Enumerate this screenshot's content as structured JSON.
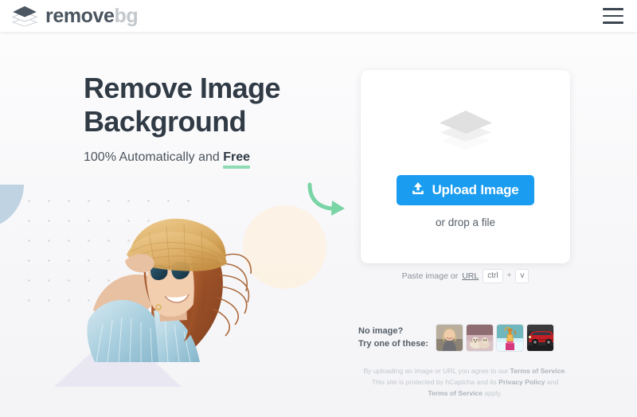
{
  "header": {
    "logo_text_primary": "remove",
    "logo_text_secondary": "bg",
    "logo_icon": "layers-icon",
    "menu_icon": "hamburger-menu-icon"
  },
  "hero": {
    "title_line1": "Remove Image",
    "title_line2": "Background",
    "subtitle_prefix": "100% Automatically and ",
    "subtitle_highlight": "Free",
    "photo_alt": "woman-with-straw-hat-and-sunglasses",
    "arrow_icon": "curved-arrow-right-icon"
  },
  "upload": {
    "card_icon": "layers-placeholder-icon",
    "button_label": "Upload Image",
    "button_icon": "upload-icon",
    "button_color": "#1a9cf0",
    "drop_text": "or drop a file",
    "paste_prefix": "Paste image or ",
    "paste_link": "URL",
    "key_ctrl": "ctrl",
    "key_plus": "+",
    "key_v": "v"
  },
  "samples": {
    "label_line1": "No image?",
    "label_line2": "Try one of these:",
    "thumbnails": [
      {
        "name": "sample-woman"
      },
      {
        "name": "sample-dog"
      },
      {
        "name": "sample-perfume-bottle"
      },
      {
        "name": "sample-red-car"
      }
    ]
  },
  "legal": {
    "line1_a": "By uploading an image or URL you agree to our ",
    "line1_link": "Terms of Service",
    "line1_b": ".",
    "line2_a": "This site is protected by hCaptcha and its ",
    "line2_link": "Privacy Policy",
    "line2_b": " and",
    "line3_link": "Terms of Service",
    "line3_b": " apply."
  },
  "colors": {
    "accent_blue": "#1a9cf0",
    "highlight_green": "#8fdcb4",
    "text_dark": "#313b46",
    "logo_gray": "#c3c8cd"
  }
}
